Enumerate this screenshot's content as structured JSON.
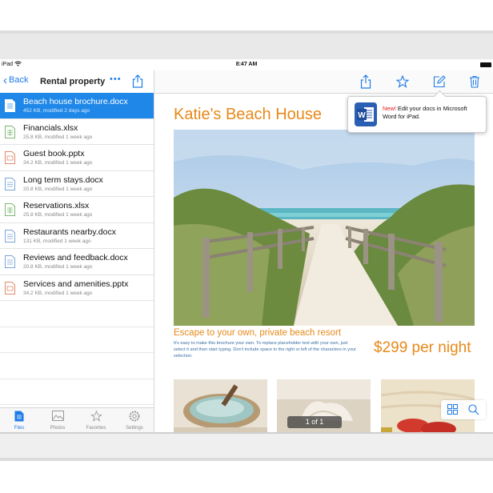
{
  "status": {
    "device": "iPad",
    "time": "8:47 AM"
  },
  "sidebar": {
    "back_label": "Back",
    "title": "Rental property",
    "more_label": "•••",
    "files": [
      {
        "name": "Beach house brochure.docx",
        "meta": "452 KB, modified 2 days ago",
        "type": "docx",
        "selected": true
      },
      {
        "name": "Financials.xlsx",
        "meta": "25.8 KB, modified 1 week ago",
        "type": "xlsx"
      },
      {
        "name": "Guest book.pptx",
        "meta": "34.2 KB, modified 1 week ago",
        "type": "pptx"
      },
      {
        "name": "Long term stays.docx",
        "meta": "20.8 KB, modified 1 week ago",
        "type": "docx"
      },
      {
        "name": "Reservations.xlsx",
        "meta": "25.8 KB, modified 1 week ago",
        "type": "xlsx"
      },
      {
        "name": "Restaurants nearby.docx",
        "meta": "131 KB, modified 1 week ago",
        "type": "docx"
      },
      {
        "name": "Reviews and feedback.docx",
        "meta": "20.8 KB, modified 1 week ago",
        "type": "docx"
      },
      {
        "name": "Services and amenities.pptx",
        "meta": "34.2 KB, modified 1 week ago",
        "type": "pptx"
      }
    ],
    "tabs": [
      {
        "label": "Files",
        "icon": "files-icon",
        "active": true
      },
      {
        "label": "Photos",
        "icon": "photos-icon"
      },
      {
        "label": "Favorites",
        "icon": "star-icon"
      },
      {
        "label": "Settings",
        "icon": "gear-icon"
      }
    ]
  },
  "toolbar": {
    "icons": [
      "share-icon",
      "star-icon",
      "edit-icon",
      "trash-icon"
    ]
  },
  "document": {
    "title": "Katie's Beach House",
    "subhead": "Escape to your own, private beach resort",
    "body": "It's easy to make this brochure your own. To replace placeholder text with your own, just select it and then start typing. Don't include space to the right or left of the characters in your selection.",
    "price": "$299 per night",
    "pager": "1 of 1"
  },
  "popover": {
    "new_label": "New!",
    "text": " Edit your docs in Microsoft Word for iPad.",
    "icon_letter": "W"
  },
  "colors": {
    "accent": "#1f87e8",
    "orange": "#e8891a",
    "new": "#e02020"
  }
}
